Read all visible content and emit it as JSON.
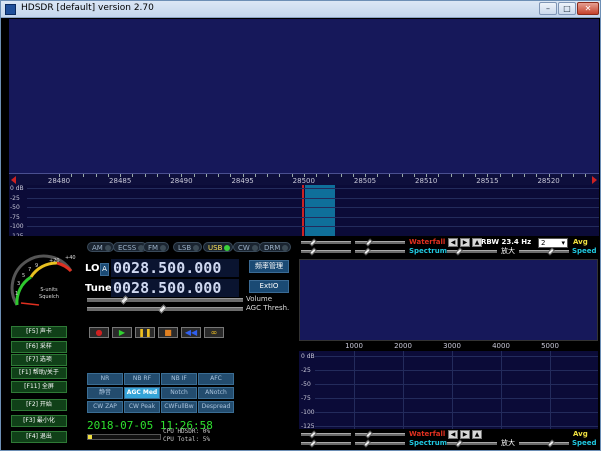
{
  "window": {
    "title": "HDSDR [default]  version 2.70",
    "controls": {
      "minimize": "–",
      "maximize": "□",
      "close": "✕"
    }
  },
  "main_spectrum": {
    "freq_labels": [
      "28480",
      "28485",
      "28490",
      "28495",
      "28500",
      "28505",
      "28510",
      "28515",
      "28520"
    ],
    "db_labels": [
      "0 dB",
      "-25",
      "-50",
      "-75",
      "-100",
      "-125"
    ]
  },
  "modes": [
    {
      "label": "AM",
      "active": false
    },
    {
      "label": "ECSS",
      "active": false
    },
    {
      "label": "FM",
      "active": false
    },
    {
      "label": "LSB",
      "active": false
    },
    {
      "label": "USB",
      "active": true
    },
    {
      "label": "CW",
      "active": false
    },
    {
      "label": "DRM",
      "active": false
    }
  ],
  "smeter": {
    "scale": [
      "1",
      "3",
      "5",
      "7",
      "9",
      "+20",
      "+40"
    ],
    "caption_line1": "S-units",
    "caption_line2": "Squelch"
  },
  "lo": {
    "label": "LO",
    "lock_icon": "A",
    "value": "0028.500.000"
  },
  "tune": {
    "label": "Tune",
    "value": "0028.500.000"
  },
  "buttons": {
    "freq_mgr": "频率管理",
    "extio": "ExtIO"
  },
  "volume_label": "Volume",
  "agc_label": "AGC Thresh.",
  "fkeys": [
    "[F5] 声卡",
    "[F6] 采样",
    "[F7] 选项",
    "[F1] 帮助/关于",
    "[F11] 全屏",
    "[F2] 开始",
    "[F3] 最小化",
    "[F4] 退出"
  ],
  "transport": [
    {
      "name": "record-button",
      "glyph": "●",
      "color": "#d02020"
    },
    {
      "name": "play-button",
      "glyph": "▶",
      "color": "#30d030"
    },
    {
      "name": "pause-button",
      "glyph": "❚❚",
      "color": "#f0c020"
    },
    {
      "name": "stop-button",
      "glyph": "■",
      "color": "#e08020"
    },
    {
      "name": "rewind-button",
      "glyph": "◀◀",
      "color": "#3060f0"
    },
    {
      "name": "loop-button",
      "glyph": "∞",
      "color": "#f0c020"
    }
  ],
  "dsp_buttons": [
    [
      {
        "label": "NR",
        "on": false
      },
      {
        "label": "NB RF",
        "on": false
      },
      {
        "label": "NB IF",
        "on": false
      },
      {
        "label": "AFC",
        "on": false
      }
    ],
    [
      {
        "label": "静音",
        "on": false
      },
      {
        "label": "AGC Med",
        "on": true
      },
      {
        "label": "Notch",
        "on": false
      },
      {
        "label": "ANotch",
        "on": false
      }
    ],
    [
      {
        "label": "CW ZAP",
        "on": false
      },
      {
        "label": "CW Peak",
        "on": false
      },
      {
        "label": "CWFullBw",
        "on": false
      },
      {
        "label": "Despread",
        "on": false
      }
    ]
  ],
  "clock": "2018-07-05 11:26:58",
  "cpu": {
    "hdsdr": "CPU HDSDR:  0%",
    "total": "CPU Total:  5%"
  },
  "zoom_panel": {
    "waterfall_label": "Waterfall",
    "spectrum_label": "Spectrum",
    "rbw": "RBW 23.4 Hz",
    "avg_value": "2",
    "avg_label": "Avg",
    "zoom_label": "放大",
    "speed_label": "Speed",
    "axis_labels": [
      "1000",
      "2000",
      "3000",
      "4000",
      "5000"
    ],
    "db_labels": [
      "0 dB",
      "-25",
      "-50",
      "-75",
      "-100",
      "-125"
    ],
    "arrows": [
      "◀",
      "▶",
      "▲",
      "▼"
    ]
  },
  "colors": {
    "waterfall": "#16185a",
    "spectrum_bg": "#0b0b38",
    "rx_band": "#0f6f9a",
    "accent_green": "#2ee02e"
  }
}
